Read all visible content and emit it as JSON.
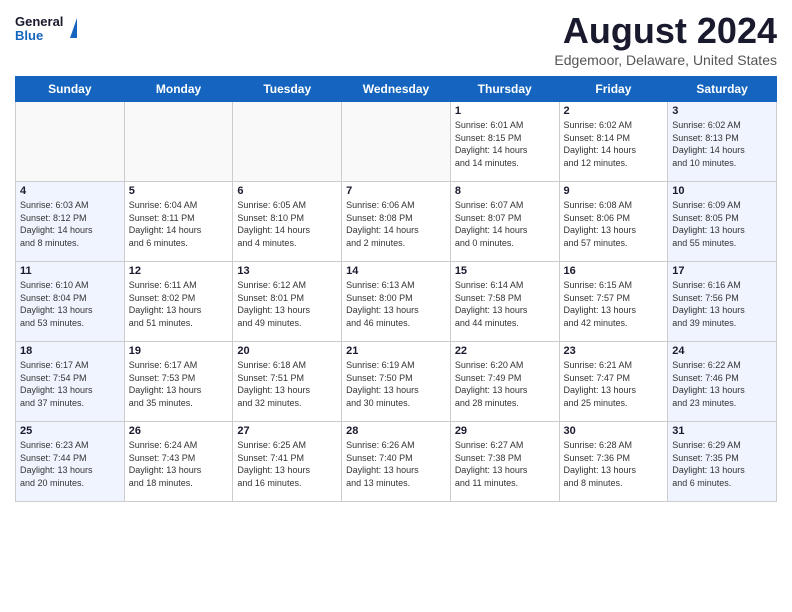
{
  "logo": {
    "general": "General",
    "blue": "Blue"
  },
  "title": "August 2024",
  "location": "Edgemoor, Delaware, United States",
  "days_of_week": [
    "Sunday",
    "Monday",
    "Tuesday",
    "Wednesday",
    "Thursday",
    "Friday",
    "Saturday"
  ],
  "weeks": [
    [
      {
        "day": "",
        "info": "",
        "type": "empty"
      },
      {
        "day": "",
        "info": "",
        "type": "empty"
      },
      {
        "day": "",
        "info": "",
        "type": "empty"
      },
      {
        "day": "",
        "info": "",
        "type": "empty"
      },
      {
        "day": "1",
        "info": "Sunrise: 6:01 AM\nSunset: 8:15 PM\nDaylight: 14 hours\nand 14 minutes.",
        "type": "weekday"
      },
      {
        "day": "2",
        "info": "Sunrise: 6:02 AM\nSunset: 8:14 PM\nDaylight: 14 hours\nand 12 minutes.",
        "type": "weekday"
      },
      {
        "day": "3",
        "info": "Sunrise: 6:02 AM\nSunset: 8:13 PM\nDaylight: 14 hours\nand 10 minutes.",
        "type": "weekend"
      }
    ],
    [
      {
        "day": "4",
        "info": "Sunrise: 6:03 AM\nSunset: 8:12 PM\nDaylight: 14 hours\nand 8 minutes.",
        "type": "weekend"
      },
      {
        "day": "5",
        "info": "Sunrise: 6:04 AM\nSunset: 8:11 PM\nDaylight: 14 hours\nand 6 minutes.",
        "type": "weekday"
      },
      {
        "day": "6",
        "info": "Sunrise: 6:05 AM\nSunset: 8:10 PM\nDaylight: 14 hours\nand 4 minutes.",
        "type": "weekday"
      },
      {
        "day": "7",
        "info": "Sunrise: 6:06 AM\nSunset: 8:08 PM\nDaylight: 14 hours\nand 2 minutes.",
        "type": "weekday"
      },
      {
        "day": "8",
        "info": "Sunrise: 6:07 AM\nSunset: 8:07 PM\nDaylight: 14 hours\nand 0 minutes.",
        "type": "weekday"
      },
      {
        "day": "9",
        "info": "Sunrise: 6:08 AM\nSunset: 8:06 PM\nDaylight: 13 hours\nand 57 minutes.",
        "type": "weekday"
      },
      {
        "day": "10",
        "info": "Sunrise: 6:09 AM\nSunset: 8:05 PM\nDaylight: 13 hours\nand 55 minutes.",
        "type": "weekend"
      }
    ],
    [
      {
        "day": "11",
        "info": "Sunrise: 6:10 AM\nSunset: 8:04 PM\nDaylight: 13 hours\nand 53 minutes.",
        "type": "weekend"
      },
      {
        "day": "12",
        "info": "Sunrise: 6:11 AM\nSunset: 8:02 PM\nDaylight: 13 hours\nand 51 minutes.",
        "type": "weekday"
      },
      {
        "day": "13",
        "info": "Sunrise: 6:12 AM\nSunset: 8:01 PM\nDaylight: 13 hours\nand 49 minutes.",
        "type": "weekday"
      },
      {
        "day": "14",
        "info": "Sunrise: 6:13 AM\nSunset: 8:00 PM\nDaylight: 13 hours\nand 46 minutes.",
        "type": "weekday"
      },
      {
        "day": "15",
        "info": "Sunrise: 6:14 AM\nSunset: 7:58 PM\nDaylight: 13 hours\nand 44 minutes.",
        "type": "weekday"
      },
      {
        "day": "16",
        "info": "Sunrise: 6:15 AM\nSunset: 7:57 PM\nDaylight: 13 hours\nand 42 minutes.",
        "type": "weekday"
      },
      {
        "day": "17",
        "info": "Sunrise: 6:16 AM\nSunset: 7:56 PM\nDaylight: 13 hours\nand 39 minutes.",
        "type": "weekend"
      }
    ],
    [
      {
        "day": "18",
        "info": "Sunrise: 6:17 AM\nSunset: 7:54 PM\nDaylight: 13 hours\nand 37 minutes.",
        "type": "weekend"
      },
      {
        "day": "19",
        "info": "Sunrise: 6:17 AM\nSunset: 7:53 PM\nDaylight: 13 hours\nand 35 minutes.",
        "type": "weekday"
      },
      {
        "day": "20",
        "info": "Sunrise: 6:18 AM\nSunset: 7:51 PM\nDaylight: 13 hours\nand 32 minutes.",
        "type": "weekday"
      },
      {
        "day": "21",
        "info": "Sunrise: 6:19 AM\nSunset: 7:50 PM\nDaylight: 13 hours\nand 30 minutes.",
        "type": "weekday"
      },
      {
        "day": "22",
        "info": "Sunrise: 6:20 AM\nSunset: 7:49 PM\nDaylight: 13 hours\nand 28 minutes.",
        "type": "weekday"
      },
      {
        "day": "23",
        "info": "Sunrise: 6:21 AM\nSunset: 7:47 PM\nDaylight: 13 hours\nand 25 minutes.",
        "type": "weekday"
      },
      {
        "day": "24",
        "info": "Sunrise: 6:22 AM\nSunset: 7:46 PM\nDaylight: 13 hours\nand 23 minutes.",
        "type": "weekend"
      }
    ],
    [
      {
        "day": "25",
        "info": "Sunrise: 6:23 AM\nSunset: 7:44 PM\nDaylight: 13 hours\nand 20 minutes.",
        "type": "weekend"
      },
      {
        "day": "26",
        "info": "Sunrise: 6:24 AM\nSunset: 7:43 PM\nDaylight: 13 hours\nand 18 minutes.",
        "type": "weekday"
      },
      {
        "day": "27",
        "info": "Sunrise: 6:25 AM\nSunset: 7:41 PM\nDaylight: 13 hours\nand 16 minutes.",
        "type": "weekday"
      },
      {
        "day": "28",
        "info": "Sunrise: 6:26 AM\nSunset: 7:40 PM\nDaylight: 13 hours\nand 13 minutes.",
        "type": "weekday"
      },
      {
        "day": "29",
        "info": "Sunrise: 6:27 AM\nSunset: 7:38 PM\nDaylight: 13 hours\nand 11 minutes.",
        "type": "weekday"
      },
      {
        "day": "30",
        "info": "Sunrise: 6:28 AM\nSunset: 7:36 PM\nDaylight: 13 hours\nand 8 minutes.",
        "type": "weekday"
      },
      {
        "day": "31",
        "info": "Sunrise: 6:29 AM\nSunset: 7:35 PM\nDaylight: 13 hours\nand 6 minutes.",
        "type": "weekend"
      }
    ]
  ]
}
